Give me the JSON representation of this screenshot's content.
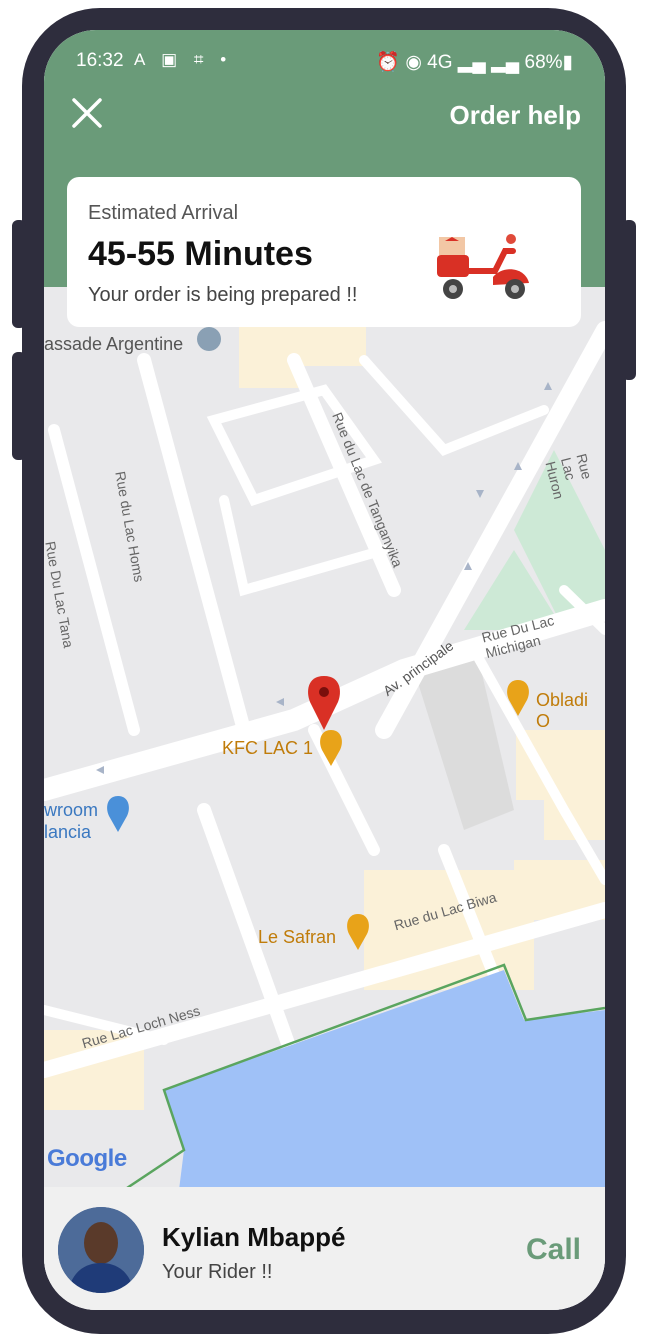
{
  "status_bar": {
    "time": "16:32",
    "left_icons": "A ▣ ⌗ •",
    "right_text": "⏰ ◉ 4G ▂▄ ▂▄ 68%▮"
  },
  "header": {
    "close_label": "Close",
    "help_label": "Order help"
  },
  "eta_card": {
    "label": "Estimated Arrival",
    "time_range": "45-55 Minutes",
    "status": "Your order is being prepared !!"
  },
  "map": {
    "labels": {
      "embassy": "assade Argentine",
      "rue_homs": "Rue du Lac Homs",
      "rue_tanganyika": "Rue du Lac de Tanganyika",
      "rue_huron": "Rue Lac Huron",
      "rue_tana": "Rue Du Lac Tana",
      "rue_michigan": "Rue Du Lac Michigan",
      "av_principale": "Av. principale",
      "obladi": "Obladi O",
      "kfc": "KFC LAC 1",
      "showroom_1": "wroom",
      "showroom_2": "lancia",
      "safran": "Le Safran",
      "rue_biwa": "Rue du Lac Biwa",
      "rue_loch_ness": "Rue Lac Loch Ness"
    },
    "google": "Google"
  },
  "rider": {
    "name": "Kylian Mbappé",
    "role": "Your Rider !!",
    "call_label": "Call"
  },
  "colors": {
    "header": "#6a9b79",
    "pin": "#d93025",
    "poi_orange": "#e8a319",
    "water": "#9fc1f7",
    "park": "#cde9d6"
  }
}
